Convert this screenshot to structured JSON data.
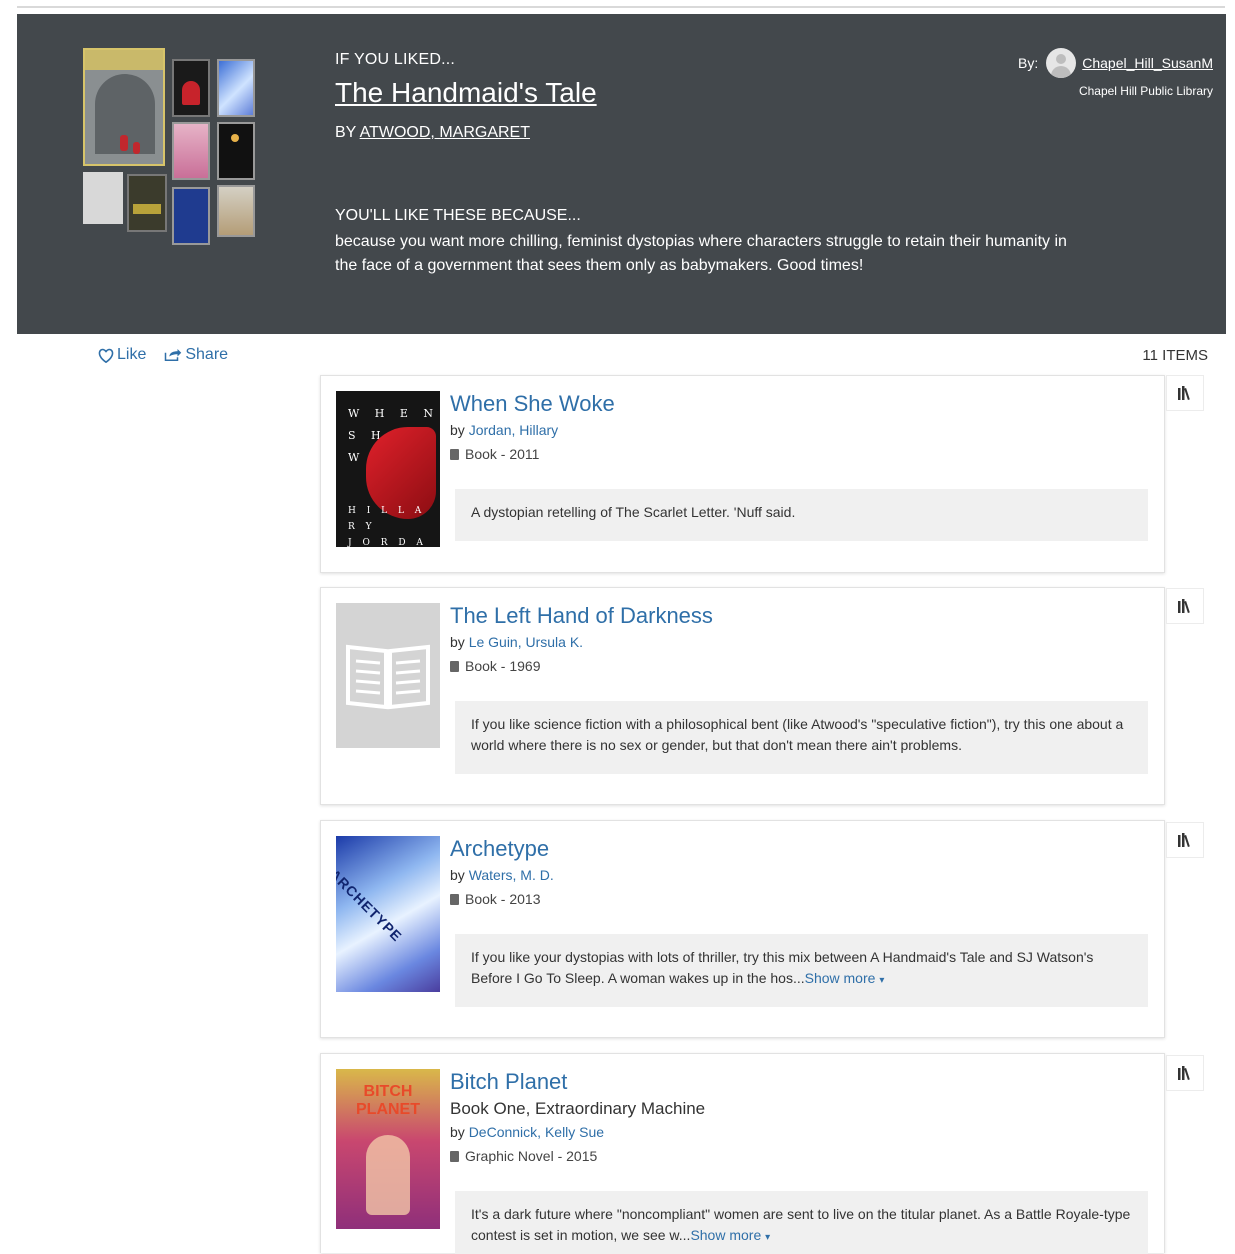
{
  "hero": {
    "kicker": "IF YOU LIKED...",
    "title": "The Handmaid's Tale",
    "author_prefix": "BY",
    "author": "ATWOOD, MARGARET",
    "because_heading": "YOU'LL LIKE THESE BECAUSE...",
    "because_text": "because you want more chilling, feminist dystopias where characters struggle to retain their humanity in the face of a government that sees them only as babymakers. Good times!",
    "by_label": "By:",
    "user": "Chapel_Hill_SusanM",
    "library": "Chapel Hill Public Library"
  },
  "actions": {
    "like": "Like",
    "share": "Share",
    "count": "11 ITEMS"
  },
  "items": [
    {
      "title": "When She Woke",
      "subtitle": "",
      "by": "by",
      "author": "Jordan, Hillary",
      "format": "Book - 2011",
      "note": "A dystopian retelling of The Scarlet Letter. 'Nuff said.",
      "show_more": ""
    },
    {
      "title": "The Left Hand of Darkness",
      "subtitle": "",
      "by": "by",
      "author": "Le Guin, Ursula K.",
      "format": "Book - 1969",
      "note": "If you like science fiction with a philosophical bent (like Atwood's \"speculative fiction\"), try this one about a world where there is no sex or gender, but that don't mean there ain't problems.",
      "show_more": ""
    },
    {
      "title": "Archetype",
      "subtitle": "",
      "by": "by",
      "author": "Waters, M. D.",
      "format": "Book - 2013",
      "note": "If you like your dystopias with lots of thriller, try this mix between A Handmaid's Tale and SJ Watson's Before I Go To Sleep. A woman wakes up in the hos...",
      "show_more": "Show more"
    },
    {
      "title": "Bitch Planet",
      "subtitle": "Book One, Extraordinary Machine",
      "by": "by",
      "author": "DeConnick, Kelly Sue",
      "format": "Graphic Novel - 2015",
      "note": "It's a dark future where \"noncompliant\" women are sent to live on the titular planet. As a Battle Royale-type contest is set in motion, we see w...",
      "show_more": "Show more"
    }
  ],
  "covers": {
    "when_she_woke": {
      "letters": [
        "W H E N",
        "S H E",
        "W O K E"
      ],
      "author": "H I L L A R Y",
      "author2": "J O R D A N"
    },
    "archetype": {
      "word": "ARCHETYPE"
    },
    "bitch_planet": {
      "word": "BITCH PLANET"
    }
  }
}
